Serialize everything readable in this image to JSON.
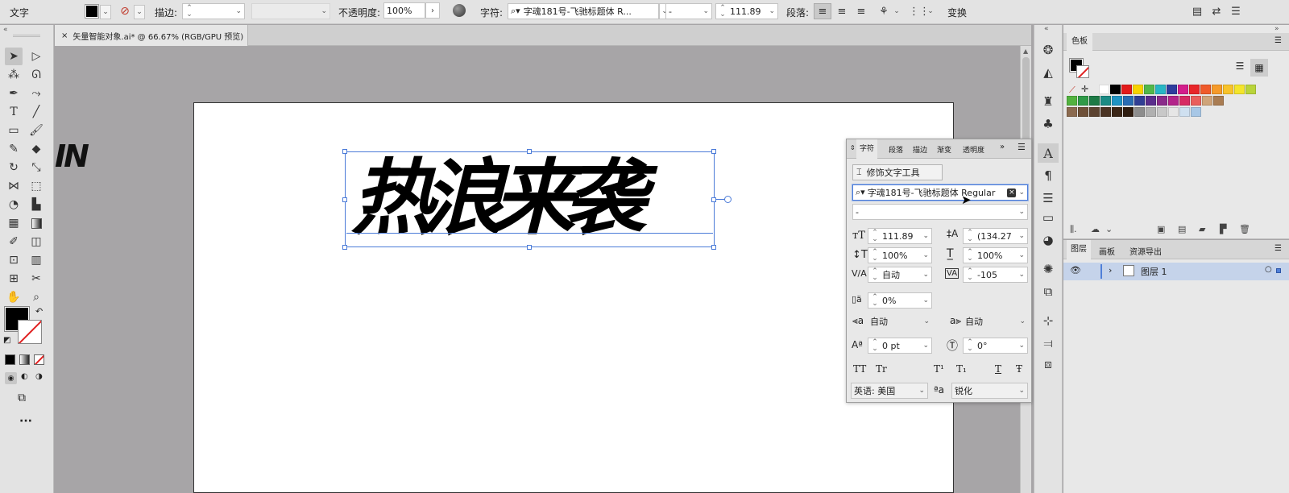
{
  "control_bar": {
    "tool_name": "文字",
    "stroke_label": "描边:",
    "opacity_label": "不透明度:",
    "opacity_value": "100%",
    "char_label": "字符:",
    "font_name": "字魂181号-飞驰标题体 R...",
    "font_style": "-",
    "font_size": "111.89",
    "para_label": "段落:",
    "transform_label": "变换"
  },
  "document_tab": {
    "title": "矢量智能对象.ai* @ 66.67% (RGB/GPU 预览)",
    "close_glyph": "×"
  },
  "canvas": {
    "artwork_text": "热浪来袭",
    "partial_text": "IN"
  },
  "character_panel": {
    "tabs": [
      "字符",
      "段落",
      "描边",
      "渐变",
      "透明度"
    ],
    "touch_type_button": "修饰文字工具",
    "font_family": "字魂181号-飞驰标题体 Regular",
    "font_style": "-",
    "font_size": "111.89",
    "leading": "(134.27",
    "vertical_scale": "100%",
    "horizontal_scale": "100%",
    "kerning": "自动",
    "tracking": "-105",
    "tsume": "0%",
    "insert_space_left": "自动",
    "insert_space_right": "自动",
    "baseline_shift": "0 pt",
    "rotation": "0°",
    "style_buttons": [
      "TT",
      "Tr",
      "T¹",
      "T₁",
      "T",
      "Ŧ"
    ],
    "language": "英语: 美国",
    "aa_label": "ªa",
    "antialias": "锐化"
  },
  "swatches_panel": {
    "tab": "色板",
    "colors_row1": [
      "#ffffff",
      "#000000",
      "#e21a1a",
      "#f7d300",
      "#52b84a",
      "#27b6c5",
      "#2e3d9e",
      "#d31e8b",
      "#e8262a",
      "#ef5a2a",
      "#f59a2a",
      "#f8c32a",
      "#f4e52a",
      "#b9d43a"
    ],
    "colors_row2": [
      "#52b23f",
      "#2f9a48",
      "#1d7a45",
      "#1b8b84",
      "#1f93c3",
      "#2a6cb2",
      "#303e94",
      "#5a2d8c",
      "#8a2b8a",
      "#b3248a",
      "#d72a63",
      "#e95f5c",
      "#cfa47a",
      "#a97c52"
    ],
    "colors_row3": [
      "#8b6a4f",
      "#6e5038",
      "#5c4330",
      "#4b3424",
      "#3b2617",
      "#2f1d10",
      "#8d8d8d",
      "#b0b0b0",
      "#c8c8c8",
      "#e6e6e6",
      "#cfe0f0",
      "#a7c7e6"
    ]
  },
  "layers_panel": {
    "tabs": [
      "图层",
      "画板",
      "资源导出"
    ],
    "layer_name": "图层 1"
  }
}
